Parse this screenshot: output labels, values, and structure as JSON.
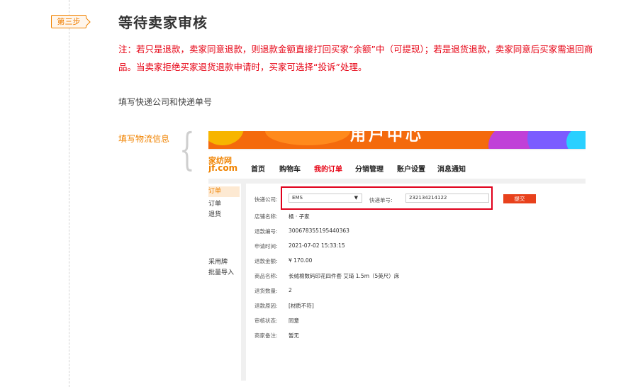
{
  "step": {
    "badge": "第三步",
    "title": "等待卖家审核",
    "note": "注：若只是退款，卖家同意退款，则退款金额直接打回买家“余额”中（可提现）；若是退货退款，卖家同意后买家需退回商品。当卖家拒绝买家退货退款申请时，买家可选择“投诉”处理。",
    "subtitle": "填写快递公司和快递单号",
    "logistics_label": "填写物流信息"
  },
  "screenshot": {
    "banner_text": "用户中心",
    "logo": {
      "line1": "家纺网",
      "line2": "jf.com"
    },
    "nav": [
      "首页",
      "购物车",
      "我的订单",
      "分销管理",
      "账户设置",
      "消息通知"
    ],
    "nav_active": "我的订单",
    "sidebar": [
      "订单",
      "订单",
      "退货",
      "采用牌",
      "批量导入"
    ],
    "form": {
      "company_label": "快递公司:",
      "company_value": "EMS",
      "tracking_label": "快递单号:",
      "tracking_value": "232134214122",
      "submit_label": "提交"
    },
    "details": [
      {
        "label": "店铺名称:",
        "value": "橘 · 子家"
      },
      {
        "label": "退款编号:",
        "value": "300678355195440363"
      },
      {
        "label": "申请时间:",
        "value": "2021-07-02 15:33:15"
      },
      {
        "label": "退款金额:",
        "value": "¥ 170.00"
      },
      {
        "label": "商品名称:",
        "value": "长绒棉数码印花四件套 艾琦 1.5m（5英尺）床"
      },
      {
        "label": "退货数量:",
        "value": "2"
      },
      {
        "label": "退款原因:",
        "value": "[材质不符]"
      },
      {
        "label": "审核状态:",
        "value": "同意"
      },
      {
        "label": "商家备注:",
        "value": "暂无"
      }
    ]
  },
  "colors": {
    "accent": "#f08300",
    "warning": "#e60012",
    "banner": "#f46a0c"
  }
}
